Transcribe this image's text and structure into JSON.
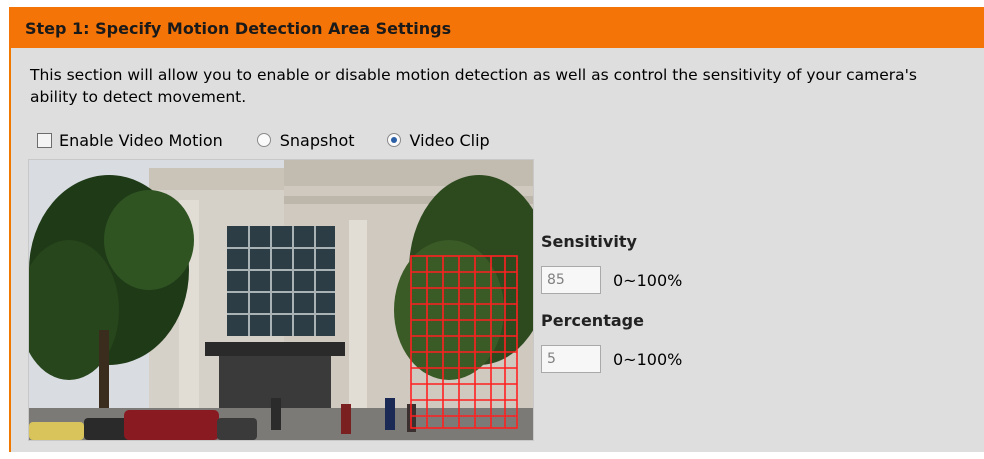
{
  "header": {
    "title": "Step 1: Specify Motion Detection Area Settings"
  },
  "description": "This section will allow you to enable or disable motion detection as well as control the sensitivity of your camera's ability to detect movement.",
  "options": {
    "enable_label": "Enable Video Motion",
    "enable_checked": false,
    "snapshot_label": "Snapshot",
    "video_clip_label": "Video Clip",
    "selected_mode": "Video Clip"
  },
  "sensitivity": {
    "label": "Sensitivity",
    "value": "85",
    "range": "0~100%"
  },
  "percentage": {
    "label": "Percentage",
    "value": "5",
    "range": "0~100%"
  },
  "colors": {
    "header": "#f47408",
    "panel": "#dedede",
    "grid": "#ff2020"
  }
}
